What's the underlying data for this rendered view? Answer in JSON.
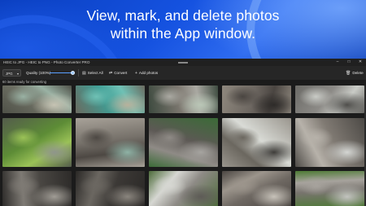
{
  "banner": {
    "line1": "View, mark, and delete photos",
    "line2": "within the App window."
  },
  "window": {
    "title": "HEIC to JPG - HEIC to PNG - Photo Converter PRO",
    "controls": {
      "minimize": "–",
      "maximize": "□",
      "close": "✕"
    }
  },
  "toolbar": {
    "format_value": "JPG",
    "quality_label": "Quality (100%)",
    "quality_value": 1.0,
    "select_all_label": "Select All",
    "convert_label": "Convert",
    "add_photos_label": "Add photos",
    "delete_label": "Delete",
    "icons": {
      "select_all": "select-all-icon",
      "convert": "convert-icon",
      "add": "plus-icon",
      "delete": "trash-icon"
    }
  },
  "status_text": "60 items ready for converting",
  "colors": {
    "accent": "#5aa0ff",
    "window_bg": "#1b1b1b",
    "banner_blue": "#1552e0"
  },
  "photos": [
    {
      "scene": "river-rocks",
      "palette": [
        "#6d6f63",
        "#9ab2a4",
        "#4f5148",
        "#c6c3b3"
      ]
    },
    {
      "scene": "turquoise-river",
      "palette": [
        "#3f9e95",
        "#6fc1b5",
        "#6b6a5f",
        "#b8b19c"
      ]
    },
    {
      "scene": "canyon-water",
      "palette": [
        "#7d7870",
        "#aaa9a2",
        "#3d4a3f",
        "#b9c6b6"
      ]
    },
    {
      "scene": "rock-wall",
      "palette": [
        "#6d6761",
        "#4a4541",
        "#8e877d",
        "#2e2b29"
      ]
    },
    {
      "scene": "gorge-light",
      "palette": [
        "#8c8a86",
        "#c9cbc6",
        "#6b6a66",
        "#4f4e4b"
      ]
    },
    {
      "scene": "green-gorge",
      "palette": [
        "#5d8c36",
        "#9bc257",
        "#545c4c",
        "#8f948c"
      ]
    },
    {
      "scene": "canyon-stream",
      "palette": [
        "#76716a",
        "#4d4843",
        "#a8a299",
        "#8fb3a6"
      ]
    },
    {
      "scene": "waterfall-gorge",
      "palette": [
        "#5d5955",
        "#8f8b86",
        "#3b6b37",
        "#a6a4a0"
      ]
    },
    {
      "scene": "rapids",
      "palette": [
        "#d9dbd6",
        "#6b675f",
        "#9a968e",
        "#3e3c39"
      ]
    },
    {
      "scene": "cliff-water",
      "palette": [
        "#807a73",
        "#b7b2aa",
        "#4d4a46",
        "#d4d6d3"
      ]
    },
    {
      "scene": "narrow-gorge",
      "palette": [
        "#4a4743",
        "#7e7a74",
        "#2d2b29",
        "#a09c95"
      ]
    },
    {
      "scene": "dark-canyon",
      "palette": [
        "#3c3936",
        "#6b6761",
        "#2a2826",
        "#8a857e"
      ]
    },
    {
      "scene": "bright-gorge",
      "palette": [
        "#8e8b86",
        "#d6d7d2",
        "#4d6b3a",
        "#5e5b57"
      ]
    },
    {
      "scene": "rock-slab",
      "palette": [
        "#6e6862",
        "#9c958c",
        "#4a4541",
        "#c7c2b9"
      ]
    },
    {
      "scene": "gorge-green",
      "palette": [
        "#78746e",
        "#a7a39d",
        "#4c7a33",
        "#c2c3bf"
      ]
    }
  ]
}
